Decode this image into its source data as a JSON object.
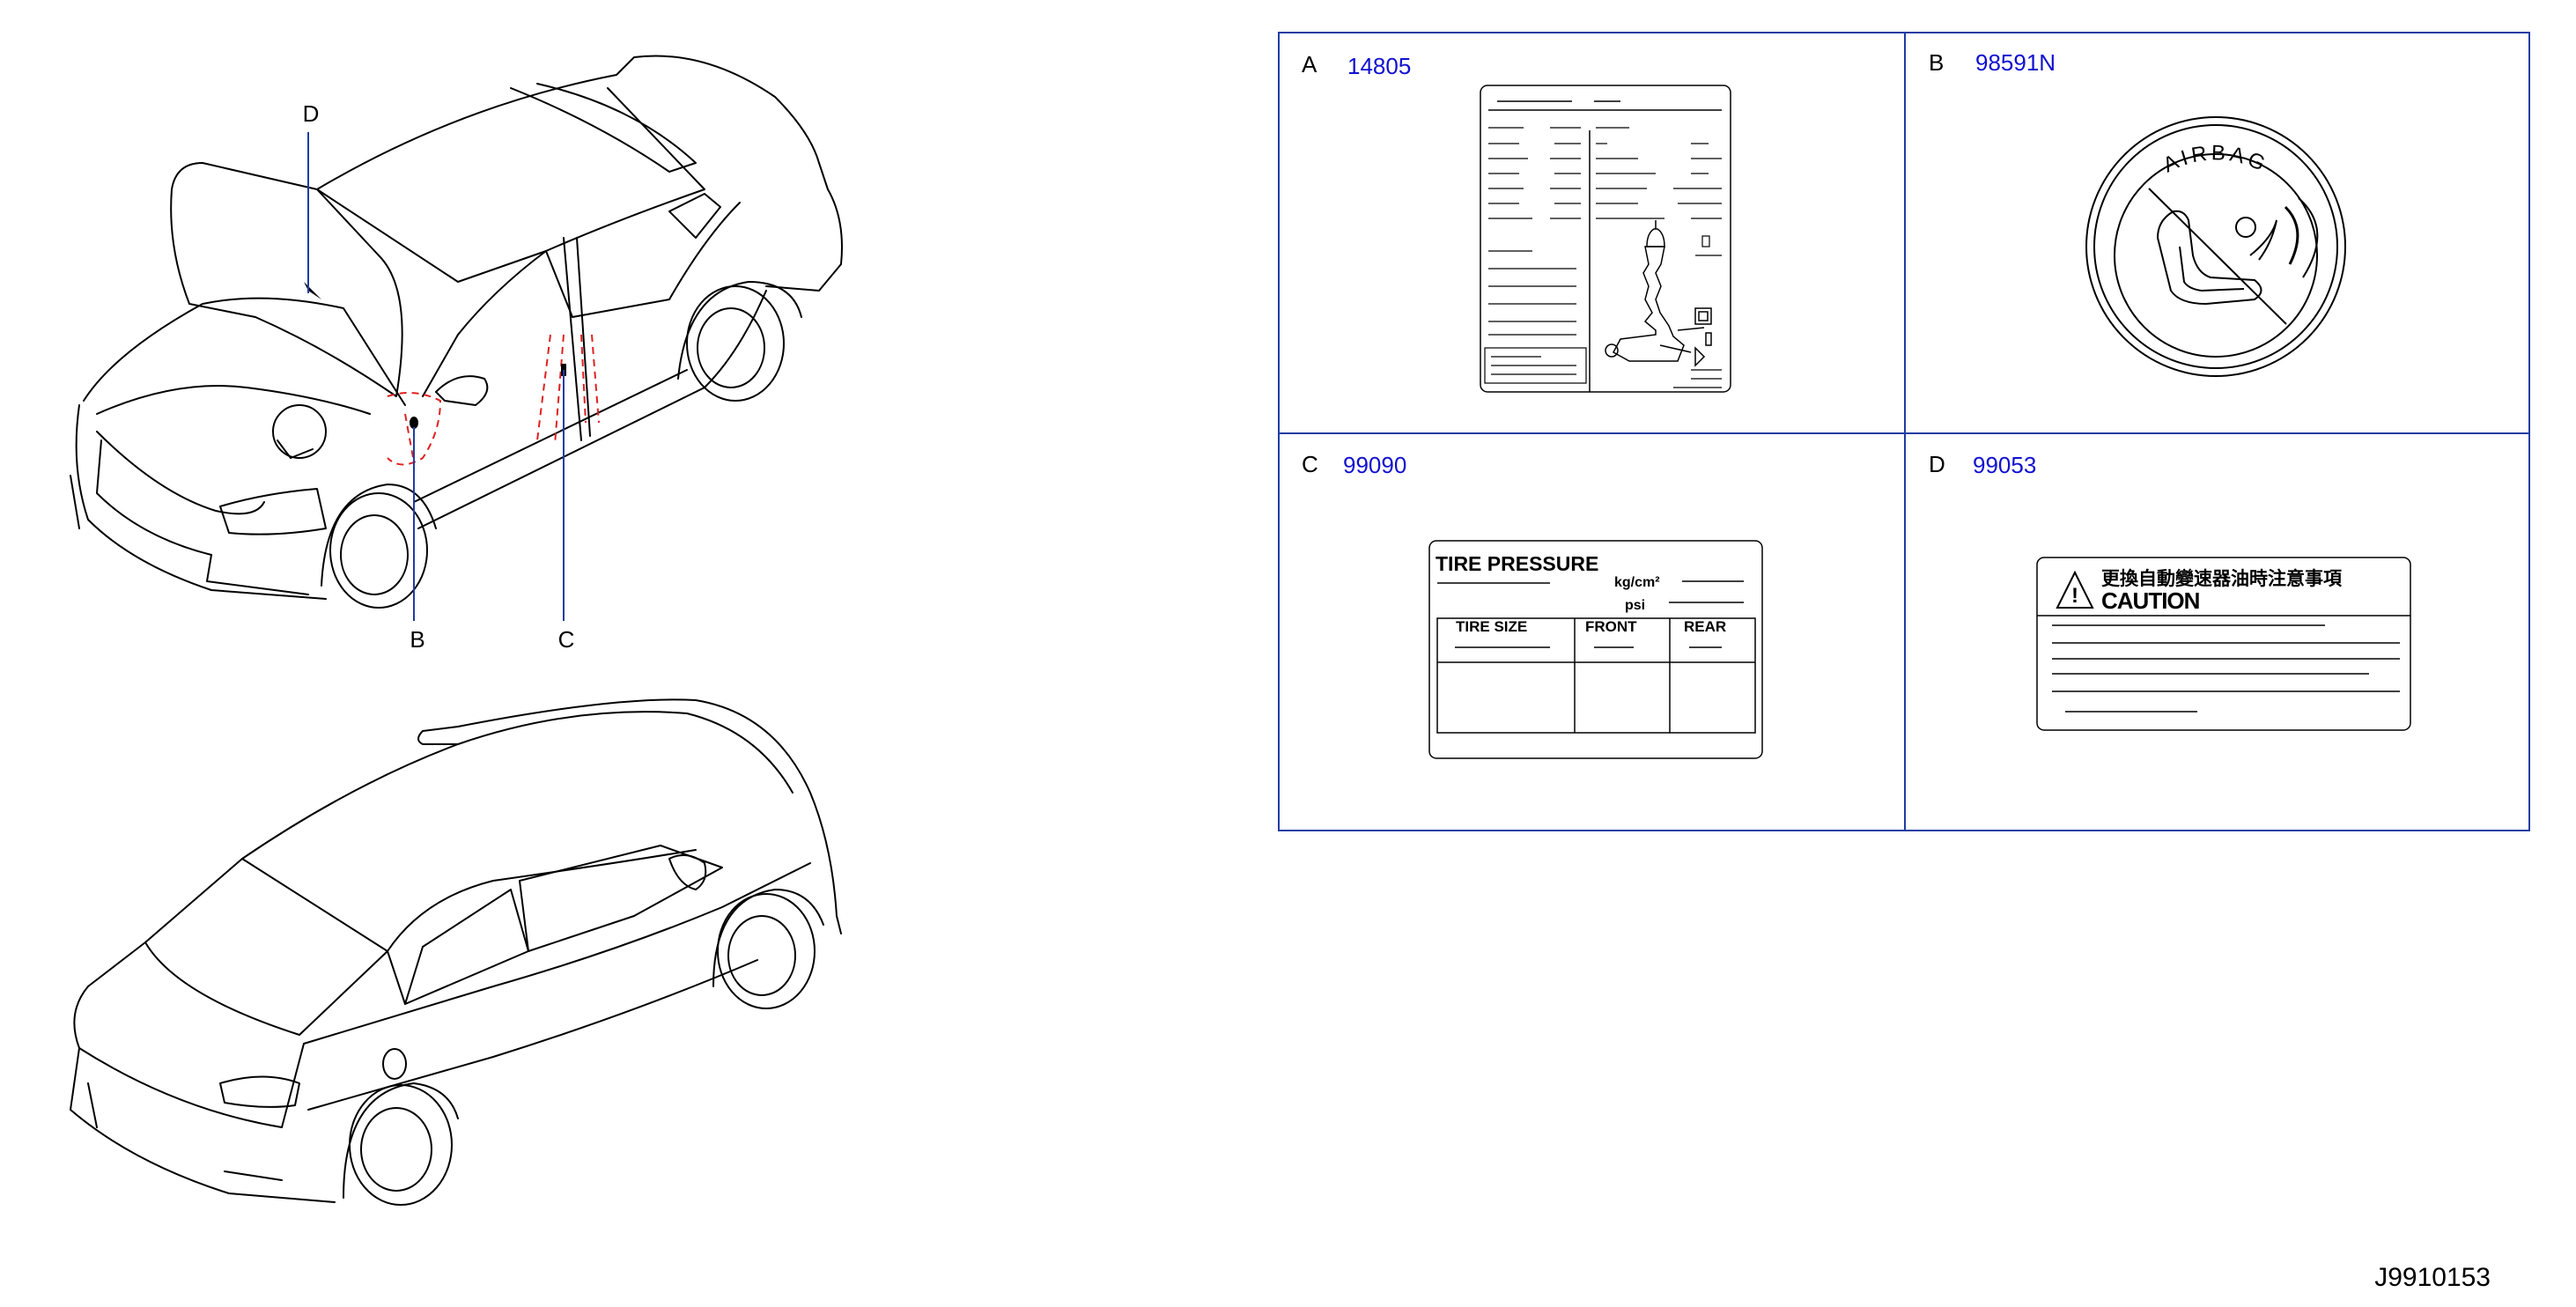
{
  "callouts": [
    "D",
    "B",
    "C"
  ],
  "panels": [
    {
      "letter": "A",
      "part_number": "14805"
    },
    {
      "letter": "B",
      "part_number": "98591N"
    },
    {
      "letter": "C",
      "part_number": "99090"
    },
    {
      "letter": "D",
      "part_number": "99053"
    }
  ],
  "airbag_label": {
    "text": "AIRBAG"
  },
  "tire_label": {
    "title": "TIRE PRESSURE",
    "unit_kg": "kg/cm²",
    "unit_psi": "psi",
    "columns": [
      "TIRE SIZE",
      "FRONT",
      "REAR"
    ]
  },
  "caution_label": {
    "chinese_text": "更換自動變速器油時注意事項",
    "caution_text": "CAUTION"
  },
  "figure_id": "J9910153",
  "colors": {
    "panel_border": "#1f3da3",
    "part_number": "#1010d0",
    "callout_line": "#1f3da3",
    "highlight": "#e02020"
  }
}
